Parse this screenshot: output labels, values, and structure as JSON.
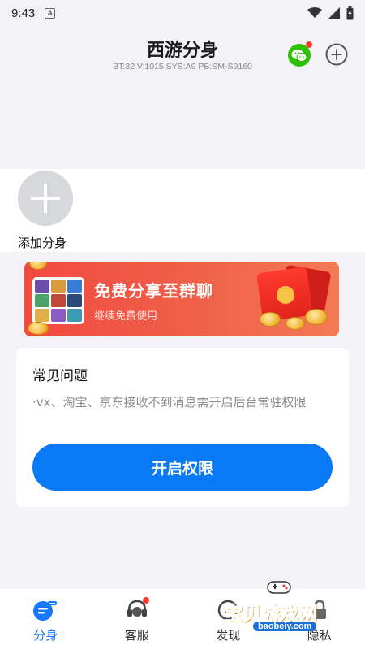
{
  "status_bar": {
    "time": "9:43",
    "notification_letter": "A"
  },
  "header": {
    "title": "西游分身",
    "build_info": "BT:32 V:1015 SYS:A9 PB:SM-S9160",
    "wechat_icon": "wechat-icon",
    "add_icon": "plus-circle-icon"
  },
  "clone_section": {
    "add_label": "添加分身"
  },
  "banner": {
    "title": "免费分享至群聊",
    "subtitle": "继续免费使用"
  },
  "faq": {
    "title": "常见问题",
    "text": "·vx、淘宝、京东接收不到消息需开启后台常驻权限",
    "button_label": "开启权限"
  },
  "bottom_nav": {
    "items": [
      {
        "label": "分身",
        "icon": "clone-icon",
        "active": true
      },
      {
        "label": "客服",
        "icon": "headset-icon",
        "active": false
      },
      {
        "label": "发现",
        "icon": "compass-icon",
        "active": false
      },
      {
        "label": "隐私",
        "icon": "lock-icon",
        "active": false
      }
    ]
  },
  "watermark": {
    "text": "宝贝游戏网",
    "url": "baobeiy.com"
  },
  "colors": {
    "accent": "#0a79f5",
    "nav_active": "#1677ff",
    "banner": "#f14a3f",
    "badge": "#ff3b30"
  }
}
